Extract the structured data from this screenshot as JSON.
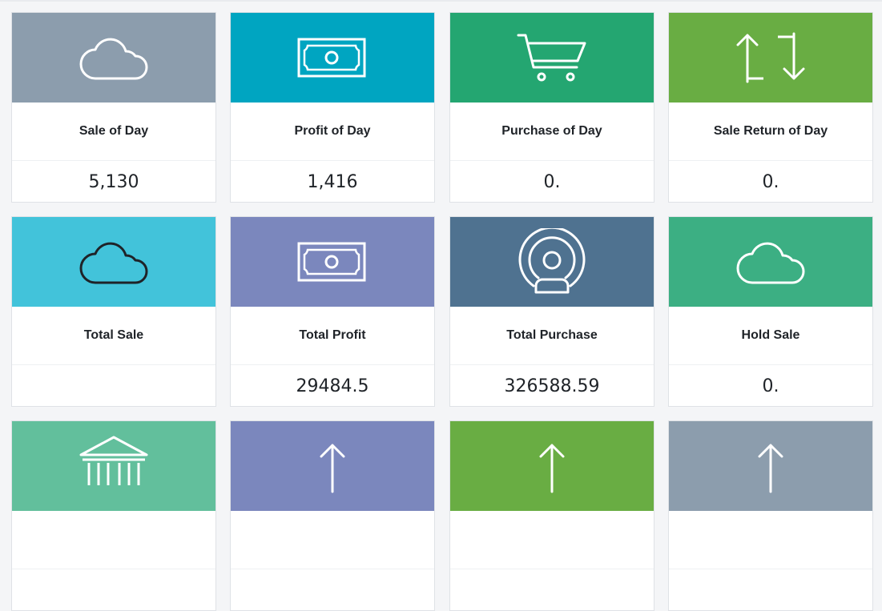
{
  "colors": {
    "slate": "#8c9dad",
    "teal": "#00a5c1",
    "green": "#24a671",
    "lime": "#69ad43",
    "cyan": "#42c3da",
    "indigo": "#7b87bd",
    "steel": "#4f7290",
    "emerald": "#3caf83",
    "mint": "#62bf9c"
  },
  "cards": [
    {
      "label": "Sale of Day",
      "value": "5,130",
      "icon": "cloud-icon"
    },
    {
      "label": "Profit of Day",
      "value": "1,416",
      "icon": "money-icon"
    },
    {
      "label": "Purchase of Day",
      "value": "0.",
      "icon": "cart-icon"
    },
    {
      "label": "Sale Return of Day",
      "value": "0.",
      "icon": "exchange-icon"
    },
    {
      "label": "Total Sale",
      "value": "",
      "icon": "cloud-icon"
    },
    {
      "label": "Total Profit",
      "value": "29484.5",
      "icon": "money-icon"
    },
    {
      "label": "Total Purchase",
      "value": "326588.59",
      "icon": "user-broadcast-icon"
    },
    {
      "label": "Hold Sale",
      "value": "0.",
      "icon": "cloud-icon"
    },
    {
      "label": "",
      "value": "",
      "icon": "bank-icon"
    },
    {
      "label": "",
      "value": "",
      "icon": "arrow-up-icon"
    },
    {
      "label": "",
      "value": "",
      "icon": "arrow-up-icon"
    },
    {
      "label": "",
      "value": "",
      "icon": "arrow-up-icon"
    }
  ]
}
